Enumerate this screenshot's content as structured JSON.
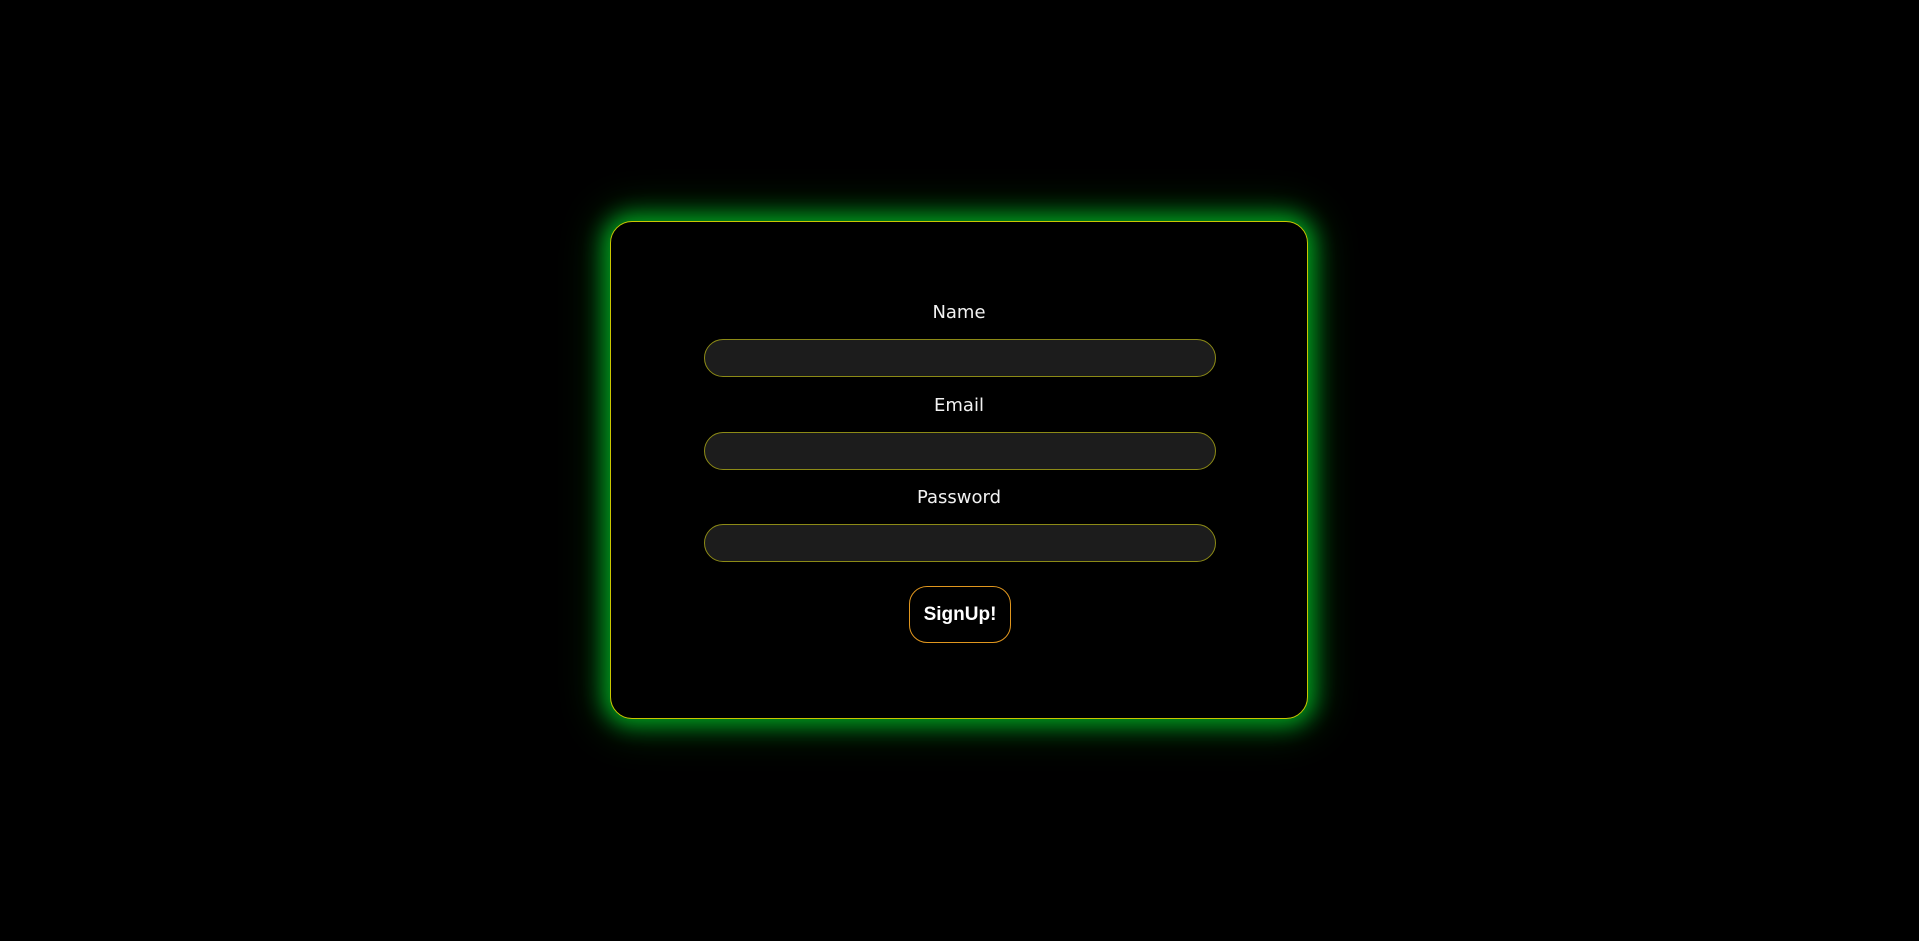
{
  "form": {
    "fields": [
      {
        "label": "Name",
        "value": "",
        "placeholder": ""
      },
      {
        "label": "Email",
        "value": "",
        "placeholder": ""
      },
      {
        "label": "Password",
        "value": "",
        "placeholder": ""
      }
    ],
    "submit_label": "SignUp!"
  },
  "colors": {
    "background": "#000000",
    "card_border": "#c9c600",
    "card_glow": "#00c828",
    "input_border": "#8c8a16",
    "input_background": "#1c1c1c",
    "button_border": "#e0961e",
    "text": "#f2f2f2"
  }
}
